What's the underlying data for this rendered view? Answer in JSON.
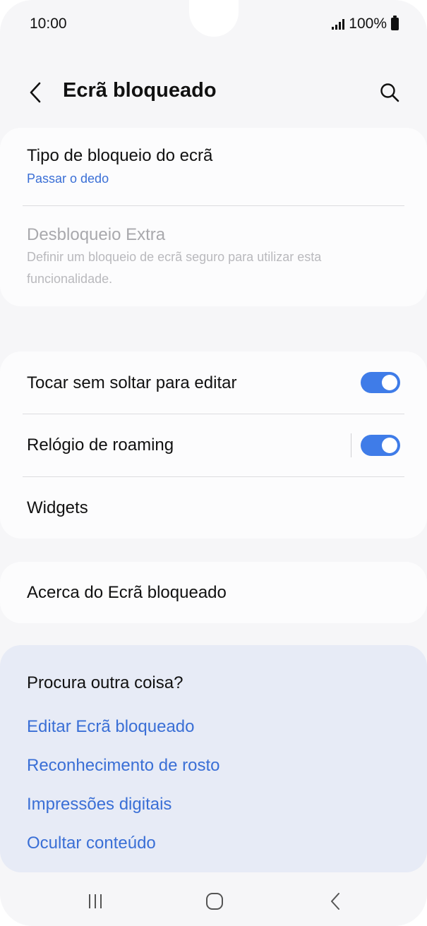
{
  "status_bar": {
    "time": "10:00",
    "battery": "100%"
  },
  "header": {
    "title": "Ecrã bloqueado"
  },
  "lock_section": {
    "lock_type_title": "Tipo de bloqueio do ecrã",
    "lock_type_value": "Passar o dedo",
    "extra_unlock_title": "Desbloqueio Extra",
    "extra_unlock_desc": "Definir um bloqueio de ecrã seguro para utilizar esta funcionalidade."
  },
  "options_section": {
    "touch_hold_label": "Tocar sem soltar para editar",
    "touch_hold_on": true,
    "roaming_clock_label": "Relógio de roaming",
    "roaming_clock_on": true,
    "widgets_label": "Widgets"
  },
  "about_section": {
    "label": "Acerca do Ecrã bloqueado"
  },
  "looking_for": {
    "title": "Procura outra coisa?",
    "links": [
      "Editar Ecrã bloqueado",
      "Reconhecimento de rosto",
      "Impressões digitais",
      "Ocultar conteúdo"
    ]
  },
  "colors": {
    "accent": "#3f7ce8",
    "link": "#3a6fd6",
    "background": "#f6f6f8",
    "card": "#fcfcfd",
    "suggestion_card": "#e7ebf6"
  },
  "icons": {
    "back": "chevron-left-icon",
    "search": "search-icon",
    "signal": "signal-icon",
    "battery": "battery-icon",
    "nav_recents": "recents-icon",
    "nav_home": "home-icon",
    "nav_back": "back-icon"
  }
}
